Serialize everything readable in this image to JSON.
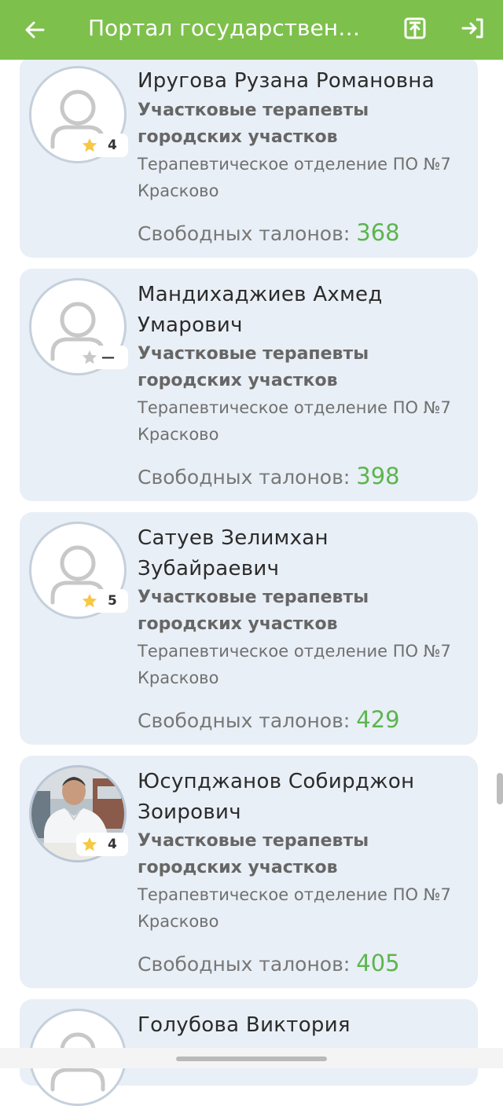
{
  "appbar": {
    "title": "Портал государственн...",
    "back_icon": "arrow-left-icon",
    "action1_icon": "upload-box-icon",
    "action2_icon": "logout-icon",
    "color": "#7dc04b"
  },
  "tickets_label": "Свободных талонов:",
  "doctors": [
    {
      "name": "Иругова Рузана Романовна",
      "specialty": "Участковые терапевты городских участков",
      "department": "Терапевтическое отделение ПО №7 Красково",
      "rating": "4",
      "rated": true,
      "tickets": "368",
      "photo": false
    },
    {
      "name": "Мандихаджиев Ахмед Умарович",
      "specialty": "Участковые терапевты городских участков",
      "department": "Терапевтическое отделение ПО №7 Красково",
      "rating": "—",
      "rated": false,
      "tickets": "398",
      "photo": false
    },
    {
      "name": "Сатуев Зелимхан Зубайраевич",
      "specialty": "Участковые терапевты городских участков",
      "department": "Терапевтическое отделение ПО №7 Красково",
      "rating": "5",
      "rated": true,
      "tickets": "429",
      "photo": false
    },
    {
      "name": "Юсупджанов Собирджон Зоирович",
      "specialty": "Участковые терапевты городских участков",
      "department": "Терапевтическое отделение ПО №7 Красково",
      "rating": "4",
      "rated": true,
      "tickets": "405",
      "photo": true
    },
    {
      "name": "Голубова Виктория",
      "photo": false,
      "partial": true
    }
  ],
  "colors": {
    "card_bg": "#e9eff6",
    "tickets_value": "#5cb54f",
    "star": "#f6c844",
    "star_inactive": "#c8c8c8"
  }
}
